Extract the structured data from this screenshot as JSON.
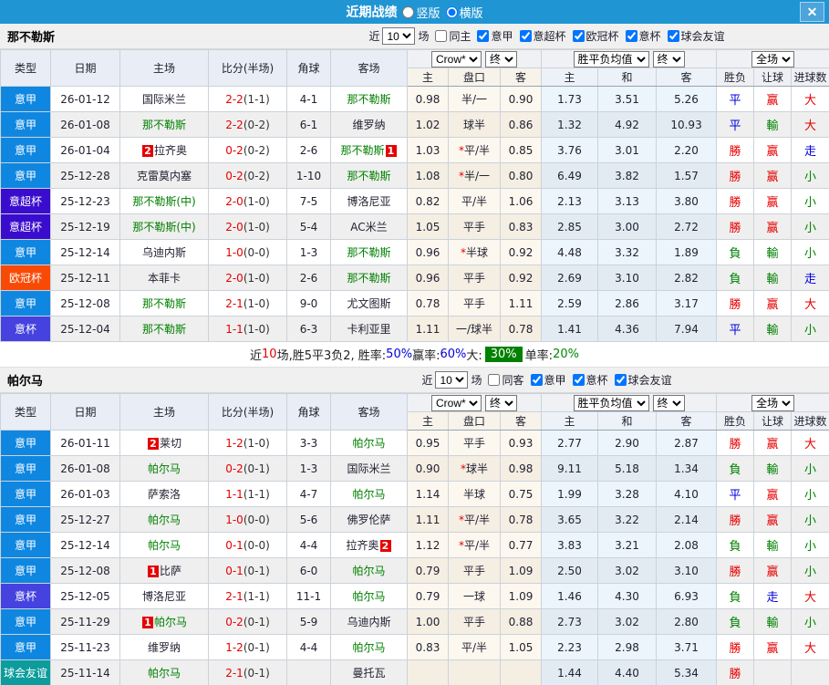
{
  "title_bar": {
    "title": "近期战绩",
    "layout_options": [
      {
        "label": "竖版",
        "selected": false
      },
      {
        "label": "横版",
        "selected": true
      }
    ],
    "close_glyph": "✕"
  },
  "colors": {
    "accent_bar": "#2095d3",
    "team_green": "#008000",
    "score_red": "#e60000",
    "result_map": {
      "勝": "#e60000",
      "赢": "#e60000",
      "大": "#e60000",
      "負": "#008000",
      "輸": "#008000",
      "小": "#008000",
      "平": "#0000dd",
      "走": "#0000dd"
    },
    "type_map": {
      "意甲": "#0f87e0",
      "意超杯": "#3a0ccd",
      "欧冠杯": "#f84a05",
      "意杯": "#4542e0",
      "球会友谊": "#0b9c9b"
    }
  },
  "table_header": {
    "left_cols": [
      "类型",
      "日期",
      "主场",
      "比分(半场)",
      "角球",
      "客场"
    ],
    "group_selects": [
      [
        "Crow*",
        "终"
      ],
      [
        "胜平负均值",
        "终"
      ],
      [
        "全场"
      ]
    ],
    "sub_cols": [
      "主",
      "盘口",
      "客",
      "主",
      "和",
      "客",
      "胜负",
      "让球",
      "进球数"
    ]
  },
  "sections": [
    {
      "team": "那不勒斯",
      "filter": {
        "near_label": "近",
        "count": "10",
        "games_label": "场",
        "same": {
          "label": "同主",
          "checked": false
        },
        "leagues": [
          {
            "label": "意甲",
            "checked": true
          },
          {
            "label": "意超杯",
            "checked": true
          },
          {
            "label": "欧冠杯",
            "checked": true
          },
          {
            "label": "意杯",
            "checked": true
          },
          {
            "label": "球会友谊",
            "checked": true
          }
        ]
      },
      "rows": [
        {
          "type": "意甲",
          "date": "26-01-12",
          "home": {
            "name": "国际米兰"
          },
          "score_full": "2-2",
          "score_half": "(1-1)",
          "corner": "4-1",
          "away": {
            "name": "那不勒斯",
            "green": true
          },
          "crow_home": "0.98",
          "handicap": "半/一",
          "handicap_star": false,
          "crow_away": "0.90",
          "avg_home": "1.73",
          "avg_draw": "3.51",
          "avg_away": "5.26",
          "wdl": "平",
          "let_ball": "赢",
          "goals": "大"
        },
        {
          "type": "意甲",
          "date": "26-01-08",
          "home": {
            "name": "那不勒斯",
            "green": true
          },
          "score_full": "2-2",
          "score_half": "(0-2)",
          "corner": "6-1",
          "away": {
            "name": "维罗纳"
          },
          "crow_home": "1.02",
          "handicap": "球半",
          "handicap_star": false,
          "crow_away": "0.86",
          "avg_home": "1.32",
          "avg_draw": "4.92",
          "avg_away": "10.93",
          "wdl": "平",
          "let_ball": "輸",
          "goals": "大"
        },
        {
          "type": "意甲",
          "date": "26-01-04",
          "home": {
            "name": "拉齐奥",
            "badge": "2"
          },
          "score_full": "0-2",
          "score_half": "(0-2)",
          "corner": "2-6",
          "away": {
            "name": "那不勒斯",
            "green": true,
            "badge": "1"
          },
          "crow_home": "1.03",
          "handicap": "平/半",
          "handicap_star": true,
          "crow_away": "0.85",
          "avg_home": "3.76",
          "avg_draw": "3.01",
          "avg_away": "2.20",
          "wdl": "勝",
          "let_ball": "赢",
          "goals": "走"
        },
        {
          "type": "意甲",
          "date": "25-12-28",
          "home": {
            "name": "克雷莫内塞"
          },
          "score_full": "0-2",
          "score_half": "(0-2)",
          "corner": "1-10",
          "away": {
            "name": "那不勒斯",
            "green": true
          },
          "crow_home": "1.08",
          "handicap": "半/一",
          "handicap_star": true,
          "crow_away": "0.80",
          "avg_home": "6.49",
          "avg_draw": "3.82",
          "avg_away": "1.57",
          "wdl": "勝",
          "let_ball": "赢",
          "goals": "小"
        },
        {
          "type": "意超杯",
          "date": "25-12-23",
          "home": {
            "name": "那不勒斯(中)",
            "green": true
          },
          "score_full": "2-0",
          "score_half": "(1-0)",
          "corner": "7-5",
          "away": {
            "name": "博洛尼亚"
          },
          "crow_home": "0.82",
          "handicap": "平/半",
          "handicap_star": false,
          "crow_away": "1.06",
          "avg_home": "2.13",
          "avg_draw": "3.13",
          "avg_away": "3.80",
          "wdl": "勝",
          "let_ball": "赢",
          "goals": "小"
        },
        {
          "type": "意超杯",
          "date": "25-12-19",
          "home": {
            "name": "那不勒斯(中)",
            "green": true
          },
          "score_full": "2-0",
          "score_half": "(1-0)",
          "corner": "5-4",
          "away": {
            "name": "AC米兰"
          },
          "crow_home": "1.05",
          "handicap": "平手",
          "handicap_star": false,
          "crow_away": "0.83",
          "avg_home": "2.85",
          "avg_draw": "3.00",
          "avg_away": "2.72",
          "wdl": "勝",
          "let_ball": "赢",
          "goals": "小"
        },
        {
          "type": "意甲",
          "date": "25-12-14",
          "home": {
            "name": "乌迪内斯"
          },
          "score_full": "1-0",
          "score_half": "(0-0)",
          "corner": "1-3",
          "away": {
            "name": "那不勒斯",
            "green": true
          },
          "crow_home": "0.96",
          "handicap": "半球",
          "handicap_star": true,
          "crow_away": "0.92",
          "avg_home": "4.48",
          "avg_draw": "3.32",
          "avg_away": "1.89",
          "wdl": "負",
          "let_ball": "輸",
          "goals": "小"
        },
        {
          "type": "欧冠杯",
          "date": "25-12-11",
          "home": {
            "name": "本菲卡"
          },
          "score_full": "2-0",
          "score_half": "(1-0)",
          "corner": "2-6",
          "away": {
            "name": "那不勒斯",
            "green": true
          },
          "crow_home": "0.96",
          "handicap": "平手",
          "handicap_star": false,
          "crow_away": "0.92",
          "avg_home": "2.69",
          "avg_draw": "3.10",
          "avg_away": "2.82",
          "wdl": "負",
          "let_ball": "輸",
          "goals": "走"
        },
        {
          "type": "意甲",
          "date": "25-12-08",
          "home": {
            "name": "那不勒斯",
            "green": true
          },
          "score_full": "2-1",
          "score_half": "(1-0)",
          "corner": "9-0",
          "away": {
            "name": "尤文图斯"
          },
          "crow_home": "0.78",
          "handicap": "平手",
          "handicap_star": false,
          "crow_away": "1.11",
          "avg_home": "2.59",
          "avg_draw": "2.86",
          "avg_away": "3.17",
          "wdl": "勝",
          "let_ball": "赢",
          "goals": "大"
        },
        {
          "type": "意杯",
          "date": "25-12-04",
          "home": {
            "name": "那不勒斯",
            "green": true
          },
          "score_full": "1-1",
          "score_half": "(1-0)",
          "corner": "6-3",
          "away": {
            "name": "卡利亚里"
          },
          "crow_home": "1.11",
          "handicap": "一/球半",
          "handicap_star": false,
          "crow_away": "0.78",
          "avg_home": "1.41",
          "avg_draw": "4.36",
          "avg_away": "7.94",
          "wdl": "平",
          "let_ball": "輸",
          "goals": "小"
        }
      ],
      "summary": [
        {
          "text": "近",
          "style": "plain"
        },
        {
          "text": "10",
          "style": "red"
        },
        {
          "text": "场,胜5平3负2, 胜率:",
          "style": "plain"
        },
        {
          "text": "50%",
          "style": "blue"
        },
        {
          "text": " 赢率:",
          "style": "plain"
        },
        {
          "text": "60%",
          "style": "blue"
        },
        {
          "text": " 大:",
          "style": "plain"
        },
        {
          "text": "30%",
          "style": "badge"
        },
        {
          "text": " 单率:",
          "style": "plain"
        },
        {
          "text": "20%",
          "style": "green"
        }
      ]
    },
    {
      "team": "帕尔马",
      "filter": {
        "near_label": "近",
        "count": "10",
        "games_label": "场",
        "same": {
          "label": "同客",
          "checked": false
        },
        "leagues": [
          {
            "label": "意甲",
            "checked": true
          },
          {
            "label": "意杯",
            "checked": true
          },
          {
            "label": "球会友谊",
            "checked": true
          }
        ]
      },
      "rows": [
        {
          "type": "意甲",
          "date": "26-01-11",
          "home": {
            "name": "莱切",
            "badge": "2"
          },
          "score_full": "1-2",
          "score_half": "(1-0)",
          "corner": "3-3",
          "away": {
            "name": "帕尔马",
            "green": true
          },
          "crow_home": "0.95",
          "handicap": "平手",
          "handicap_star": false,
          "crow_away": "0.93",
          "avg_home": "2.77",
          "avg_draw": "2.90",
          "avg_away": "2.87",
          "wdl": "勝",
          "let_ball": "赢",
          "goals": "大"
        },
        {
          "type": "意甲",
          "date": "26-01-08",
          "home": {
            "name": "帕尔马",
            "green": true
          },
          "score_full": "0-2",
          "score_half": "(0-1)",
          "corner": "1-3",
          "away": {
            "name": "国际米兰"
          },
          "crow_home": "0.90",
          "handicap": "球半",
          "handicap_star": true,
          "crow_away": "0.98",
          "avg_home": "9.11",
          "avg_draw": "5.18",
          "avg_away": "1.34",
          "wdl": "負",
          "let_ball": "輸",
          "goals": "小"
        },
        {
          "type": "意甲",
          "date": "26-01-03",
          "home": {
            "name": "萨索洛"
          },
          "score_full": "1-1",
          "score_half": "(1-1)",
          "corner": "4-7",
          "away": {
            "name": "帕尔马",
            "green": true
          },
          "crow_home": "1.14",
          "handicap": "半球",
          "handicap_star": false,
          "crow_away": "0.75",
          "avg_home": "1.99",
          "avg_draw": "3.28",
          "avg_away": "4.10",
          "wdl": "平",
          "let_ball": "赢",
          "goals": "小"
        },
        {
          "type": "意甲",
          "date": "25-12-27",
          "home": {
            "name": "帕尔马",
            "green": true
          },
          "score_full": "1-0",
          "score_half": "(0-0)",
          "corner": "5-6",
          "away": {
            "name": "佛罗伦萨"
          },
          "crow_home": "1.11",
          "handicap": "平/半",
          "handicap_star": true,
          "crow_away": "0.78",
          "avg_home": "3.65",
          "avg_draw": "3.22",
          "avg_away": "2.14",
          "wdl": "勝",
          "let_ball": "赢",
          "goals": "小"
        },
        {
          "type": "意甲",
          "date": "25-12-14",
          "home": {
            "name": "帕尔马",
            "green": true
          },
          "score_full": "0-1",
          "score_half": "(0-0)",
          "corner": "4-4",
          "away": {
            "name": "拉齐奥",
            "badge": "2"
          },
          "crow_home": "1.12",
          "handicap": "平/半",
          "handicap_star": true,
          "crow_away": "0.77",
          "avg_home": "3.83",
          "avg_draw": "3.21",
          "avg_away": "2.08",
          "wdl": "負",
          "let_ball": "輸",
          "goals": "小"
        },
        {
          "type": "意甲",
          "date": "25-12-08",
          "home": {
            "name": "比萨",
            "badge": "1"
          },
          "score_full": "0-1",
          "score_half": "(0-1)",
          "corner": "6-0",
          "away": {
            "name": "帕尔马",
            "green": true
          },
          "crow_home": "0.79",
          "handicap": "平手",
          "handicap_star": false,
          "crow_away": "1.09",
          "avg_home": "2.50",
          "avg_draw": "3.02",
          "avg_away": "3.10",
          "wdl": "勝",
          "let_ball": "赢",
          "goals": "小"
        },
        {
          "type": "意杯",
          "date": "25-12-05",
          "home": {
            "name": "博洛尼亚"
          },
          "score_full": "2-1",
          "score_half": "(1-1)",
          "corner": "11-1",
          "away": {
            "name": "帕尔马",
            "green": true
          },
          "crow_home": "0.79",
          "handicap": "一球",
          "handicap_star": false,
          "crow_away": "1.09",
          "avg_home": "1.46",
          "avg_draw": "4.30",
          "avg_away": "6.93",
          "wdl": "負",
          "let_ball": "走",
          "goals": "大"
        },
        {
          "type": "意甲",
          "date": "25-11-29",
          "home": {
            "name": "帕尔马",
            "green": true,
            "badge": "1"
          },
          "score_full": "0-2",
          "score_half": "(0-1)",
          "corner": "5-9",
          "away": {
            "name": "乌迪内斯"
          },
          "crow_home": "1.00",
          "handicap": "平手",
          "handicap_star": false,
          "crow_away": "0.88",
          "avg_home": "2.73",
          "avg_draw": "3.02",
          "avg_away": "2.80",
          "wdl": "負",
          "let_ball": "輸",
          "goals": "小"
        },
        {
          "type": "意甲",
          "date": "25-11-23",
          "home": {
            "name": "维罗纳"
          },
          "score_full": "1-2",
          "score_half": "(0-1)",
          "corner": "4-4",
          "away": {
            "name": "帕尔马",
            "green": true
          },
          "crow_home": "0.83",
          "handicap": "平/半",
          "handicap_star": false,
          "crow_away": "1.05",
          "avg_home": "2.23",
          "avg_draw": "2.98",
          "avg_away": "3.71",
          "wdl": "勝",
          "let_ball": "赢",
          "goals": "大"
        },
        {
          "type": "球会友谊",
          "date": "25-11-14",
          "home": {
            "name": "帕尔马",
            "green": true
          },
          "score_full": "2-1",
          "score_half": "(0-1)",
          "corner": "",
          "away": {
            "name": "曼托瓦"
          },
          "crow_home": "",
          "handicap": "",
          "handicap_star": false,
          "crow_away": "",
          "avg_home": "1.44",
          "avg_draw": "4.40",
          "avg_away": "5.34",
          "wdl": "勝",
          "let_ball": "",
          "goals": ""
        }
      ],
      "summary": null
    }
  ]
}
